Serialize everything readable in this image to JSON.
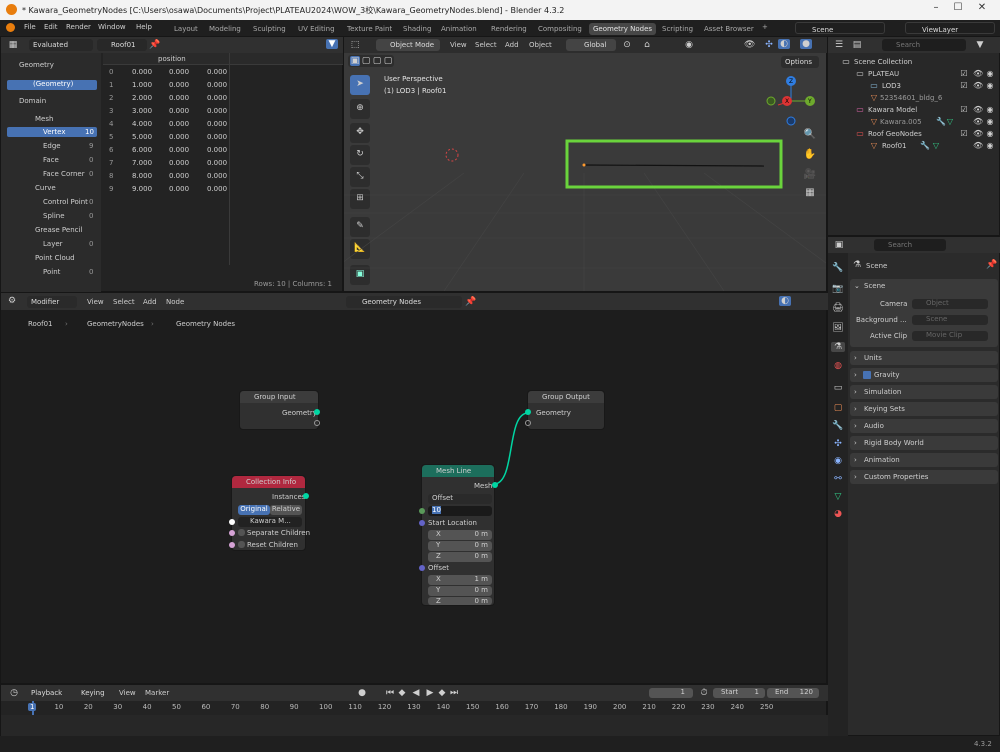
{
  "title_bar": {
    "title": "* Kawara_GeometryNodes [C:\\Users\\osawa\\Documents\\Project\\PLATEAU2024\\WOW_3校\\Kawara_GeometryNodes.blend] - Blender 4.3.2"
  },
  "menu": {
    "items": [
      "File",
      "Edit",
      "Render",
      "Window",
      "Help"
    ]
  },
  "workspaces": [
    "Layout",
    "Modeling",
    "Sculpting",
    "UV Editing",
    "Texture Paint",
    "Shading",
    "Animation",
    "Rendering",
    "Compositing",
    "Geometry Nodes",
    "Scripting",
    "Asset Browser"
  ],
  "active_workspace": "Geometry Nodes",
  "scene": {
    "label": "Scene",
    "view_layer": "ViewLayer"
  },
  "spreadsheet": {
    "mode": "Evaluated",
    "object": "Roof01",
    "sidebar_geometry": "Geometry",
    "geometry_item": "(Geometry)",
    "domain_label": "Domain",
    "domains": [
      {
        "name": "Mesh",
        "count": ""
      },
      {
        "name": "Vertex",
        "count": "10"
      },
      {
        "name": "Edge",
        "count": "9"
      },
      {
        "name": "Face",
        "count": "0"
      },
      {
        "name": "Face Corner",
        "count": "0"
      },
      {
        "name": "Curve",
        "count": ""
      },
      {
        "name": "Control Point",
        "count": "0"
      },
      {
        "name": "Spline",
        "count": "0"
      },
      {
        "name": "Grease Pencil",
        "count": ""
      },
      {
        "name": "Layer",
        "count": "0"
      },
      {
        "name": "Point Cloud",
        "count": ""
      },
      {
        "name": "Point",
        "count": "0"
      }
    ],
    "column": "position",
    "rows": [
      [
        "0",
        "0.000",
        "0.000",
        "0.000"
      ],
      [
        "1",
        "1.000",
        "0.000",
        "0.000"
      ],
      [
        "2",
        "2.000",
        "0.000",
        "0.000"
      ],
      [
        "3",
        "3.000",
        "0.000",
        "0.000"
      ],
      [
        "4",
        "4.000",
        "0.000",
        "0.000"
      ],
      [
        "5",
        "5.000",
        "0.000",
        "0.000"
      ],
      [
        "6",
        "6.000",
        "0.000",
        "0.000"
      ],
      [
        "7",
        "7.000",
        "0.000",
        "0.000"
      ],
      [
        "8",
        "8.000",
        "0.000",
        "0.000"
      ],
      [
        "9",
        "9.000",
        "0.000",
        "0.000"
      ]
    ],
    "footer": "Rows: 10 | Columns: 1"
  },
  "viewport": {
    "mode": "Object Mode",
    "menus": [
      "View",
      "Select",
      "Add",
      "Object"
    ],
    "orientation": "Global",
    "options": "Options",
    "info1": "User Perspective",
    "info2": "(1) LOD3 | Roof01"
  },
  "outliner": {
    "search": "Search",
    "items": [
      {
        "name": "Scene Collection"
      },
      {
        "name": "PLATEAU"
      },
      {
        "name": "LOD3"
      },
      {
        "name": "52354601_bldg_6"
      },
      {
        "name": "Kawara Model"
      },
      {
        "name": "Kawara.005"
      },
      {
        "name": "Roof GeoNodes"
      },
      {
        "name": "Roof01"
      }
    ]
  },
  "properties": {
    "search": "Search",
    "scene": "Scene",
    "section_scene": "Scene",
    "camera_label": "Camera",
    "camera_ph": "Object",
    "bg_label": "Background ...",
    "bg_ph": "Scene",
    "clip_label": "Active Clip",
    "clip_ph": "Movie Clip",
    "sections": [
      "Units",
      "Gravity",
      "Simulation",
      "Keying Sets",
      "Audio",
      "Rigid Body World",
      "Animation",
      "Custom Properties"
    ]
  },
  "node_editor": {
    "menus": [
      "Modifier",
      "View",
      "Select",
      "Add",
      "Node"
    ],
    "tree": "Geometry Nodes",
    "breadcrumb": [
      "Roof01",
      "GeometryNodes",
      "Geometry Nodes"
    ],
    "group_input": {
      "title": "Group Input",
      "out": "Geometry"
    },
    "group_output": {
      "title": "Group Output",
      "in": "Geometry"
    },
    "collection_info": {
      "title": "Collection Info",
      "out": "Instances",
      "opt1": "Original",
      "opt2": "Relative",
      "collection": "Kawara M...",
      "sep": "Separate Children",
      "reset": "Reset Children"
    },
    "mesh_line": {
      "title": "Mesh Line",
      "out": "Mesh",
      "mode": "Offset",
      "count": "10",
      "start": "Start Location",
      "sx": "X",
      "sxv": "0 m",
      "sy": "Y",
      "syv": "0 m",
      "sz": "Z",
      "szv": "0 m",
      "offset": "Offset",
      "ox": "X",
      "oxv": "1 m",
      "oy": "Y",
      "oyv": "0 m",
      "oz": "Z",
      "ozv": "0 m"
    }
  },
  "timeline": {
    "menus": [
      "Playback",
      "Keying",
      "View",
      "Marker"
    ],
    "frame": "1",
    "start_label": "Start",
    "start": "1",
    "end_label": "End",
    "end": "120",
    "ticks": [
      "1",
      "10",
      "20",
      "30",
      "40",
      "50",
      "60",
      "70",
      "80",
      "90",
      "100",
      "110",
      "120",
      "130",
      "140",
      "150",
      "160",
      "170",
      "180",
      "190",
      "200",
      "210",
      "220",
      "230",
      "240",
      "250"
    ]
  },
  "version": "4.3.2",
  "colors": {
    "accent": "#4772b3",
    "highlight": "#6ad43c",
    "geometry_socket": "#00d6a3",
    "collection_header": "#b0283f",
    "mesh_header": "#1c6e5c"
  }
}
